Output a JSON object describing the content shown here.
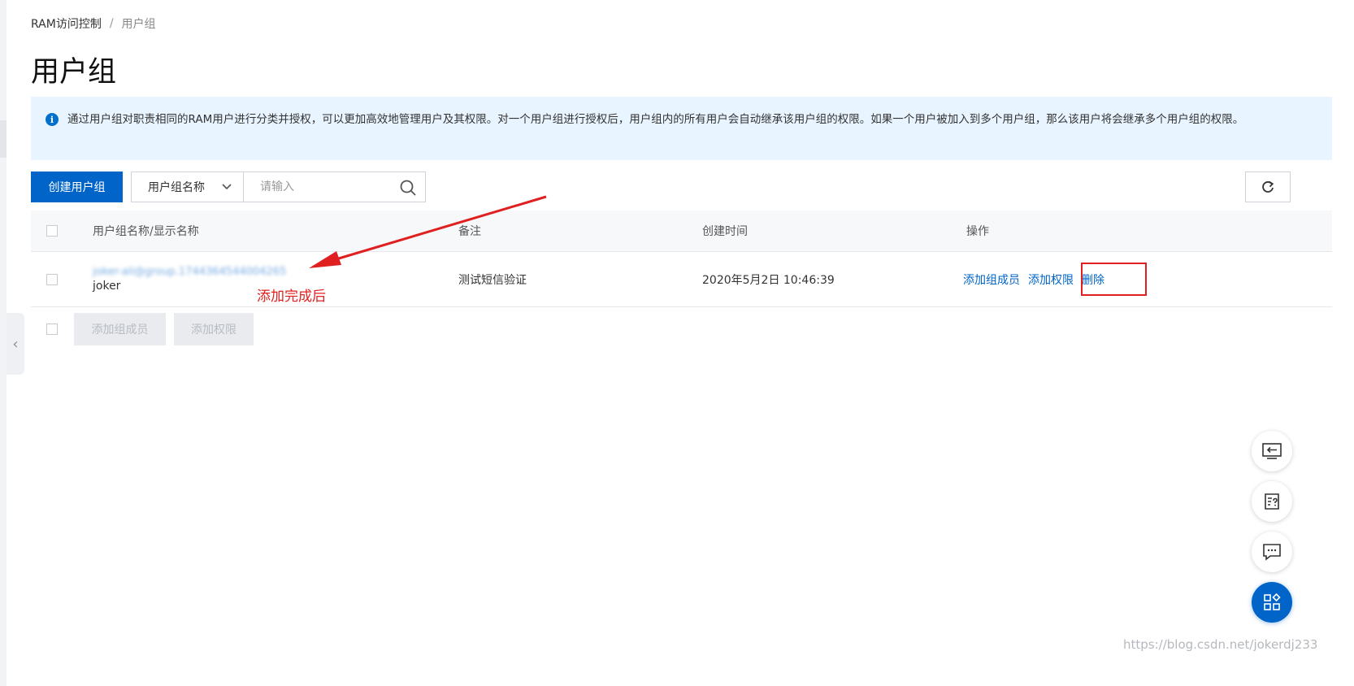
{
  "breadcrumb": {
    "root": "RAM访问控制",
    "separator": "/",
    "current": "用户组"
  },
  "page_title": "用户组",
  "info_banner": {
    "text": "通过用户组对职责相同的RAM用户进行分类并授权，可以更加高效地管理用户及其权限。对一个用户组进行授权后，用户组内的所有用户会自动继承该用户组的权限。如果一个用户被加入到多个用户组，那么该用户将会继承多个用户组的权限。"
  },
  "toolbar": {
    "create_label": "创建用户组",
    "filter_selected": "用户组名称",
    "search_placeholder": "请输入",
    "search_value": ""
  },
  "table": {
    "headers": [
      "用户组名称/显示名称",
      "备注",
      "创建时间",
      "操作"
    ],
    "rows": [
      {
        "group_name": "joker-ali@group.1744364544004265",
        "display_name": "joker",
        "remark": "测试短信验证",
        "created": "2020年5月2日 10:46:39",
        "actions": [
          "添加组成员",
          "添加权限",
          "删除"
        ]
      }
    ]
  },
  "bulk_actions": [
    "添加组成员",
    "添加权限"
  ],
  "annotation": {
    "text": "添加完成后",
    "color": "#e02020"
  },
  "floating_icons": [
    "exit-panel-icon",
    "help-doc-icon",
    "chat-icon",
    "apps-icon"
  ],
  "watermark": "https://blog.csdn.net/jokerdj233",
  "colors": {
    "primary": "#0064c8",
    "banner_bg": "#e8f4ff",
    "highlight": "#e02020"
  }
}
